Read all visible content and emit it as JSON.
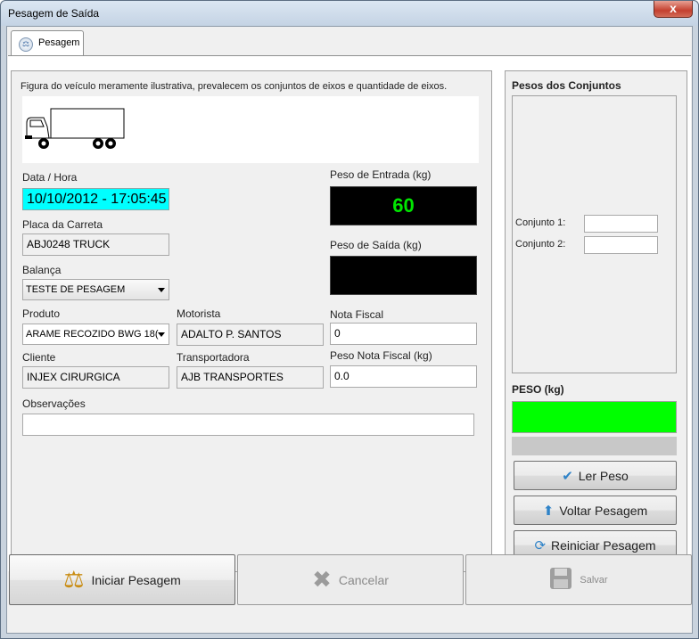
{
  "window": {
    "title": "Pesagem de Saída",
    "close_label": "x"
  },
  "tab": {
    "label": "Pesagem",
    "icon": "scale-tab-icon"
  },
  "notice": "Figura do veículo meramente ilustrativa, prevalecem os conjuntos de eixos e quantidade de eixos.",
  "form": {
    "data_hora_label": "Data / Hora",
    "data_hora_value": "10/10/2012 - 17:05:45",
    "placa_label": "Placa da Carreta",
    "placa_value": "ABJ0248 TRUCK",
    "balanca_label": "Balança",
    "balanca_value": "TESTE DE PESAGEM",
    "produto_label": "Produto",
    "produto_value": "ARAME RECOZIDO BWG 18(",
    "motorista_label": "Motorista",
    "motorista_value": "ADALTO P. SANTOS",
    "nota_fiscal_label": "Nota Fiscal",
    "nota_fiscal_value": "0",
    "cliente_label": "Cliente",
    "cliente_value": "INJEX CIRURGICA",
    "transportadora_label": "Transportadora",
    "transportadora_value": "AJB TRANSPORTES",
    "peso_nf_label": "Peso Nota Fiscal (kg)",
    "peso_nf_value": "0.0",
    "observacoes_label": "Observações",
    "observacoes_value": "",
    "peso_entrada_label": "Peso de Entrada (kg)",
    "peso_entrada_value": "60",
    "peso_saida_label": "Peso de Saída (kg)",
    "peso_saida_value": ""
  },
  "conjuntos": {
    "title": "Pesos dos Conjuntos",
    "conjunto1_label": "Conjunto 1:",
    "conjunto1_value": "",
    "conjunto2_label": "Conjunto 2:",
    "conjunto2_value": ""
  },
  "peso": {
    "label": "PESO (kg)",
    "value": ""
  },
  "side_buttons": {
    "ler_peso": "Ler Peso",
    "voltar_pesagem": "Voltar Pesagem",
    "reiniciar_pesagem": "Reiniciar Pesagem"
  },
  "bottom_buttons": {
    "iniciar": "Iniciar Pesagem",
    "cancelar": "Cancelar",
    "salvar": "Salvar"
  },
  "colors": {
    "datetime_bg": "#00ffff",
    "display_bg": "#000000",
    "display_text": "#00e600",
    "peso_green": "#00ff00",
    "progress_gray": "#c8c8c8"
  }
}
